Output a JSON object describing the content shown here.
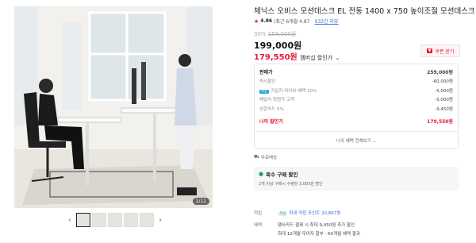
{
  "product": {
    "title": "체닉스 오비스 모션데스크 EL 전동 1400 x 750 높이조절 모션데스크",
    "rating_score": "4.86",
    "rating_detail": "(최근 6개월 4.87",
    "review_link": "933건 리뷰",
    "discount_rate": "30%",
    "original_price": "259,000원",
    "price": "199,000원",
    "member_price": "179,550원",
    "member_price_label": "멤버십 할인가",
    "coupon_label": "쿠폰 받기"
  },
  "gallery": {
    "counter": "1/11",
    "thumb_count": 5
  },
  "breakdown": {
    "rows": [
      {
        "label": "판매가",
        "value": "259,000원",
        "head": true
      },
      {
        "label": "즉시할인",
        "value": "-60,000원"
      },
      {
        "label": "가입자 라이브 혜택 10%",
        "value": "-5,000원",
        "tag": "쿠폰"
      },
      {
        "label": "패밀리 회원가 고객",
        "value": "-5,000원"
      },
      {
        "label": "신한카드 5%",
        "value": "-9,450원"
      }
    ],
    "total_label": "나의 할인가",
    "total_value": "179,550원",
    "more_label": "나의 혜택 전체보기"
  },
  "shipping": "무료배송",
  "multi_buy": {
    "title": "복수 구매 할인",
    "desc": "2개 이상 구매시 수량당 3,000원 할인"
  },
  "points": {
    "key": "적립",
    "badge": "적립",
    "text": "최대 적립 포인트 20,867원"
  },
  "payment": {
    "key": "혜택",
    "line1": "행사카드 결제 시 최대 9,450원 추가 할인",
    "line2": "최대 12개월 무이자 할부 · 60개월 혜택 결과"
  },
  "colors": {
    "accent": "#e51937",
    "blue": "#3a6fd8",
    "green": "#2aa05a"
  }
}
